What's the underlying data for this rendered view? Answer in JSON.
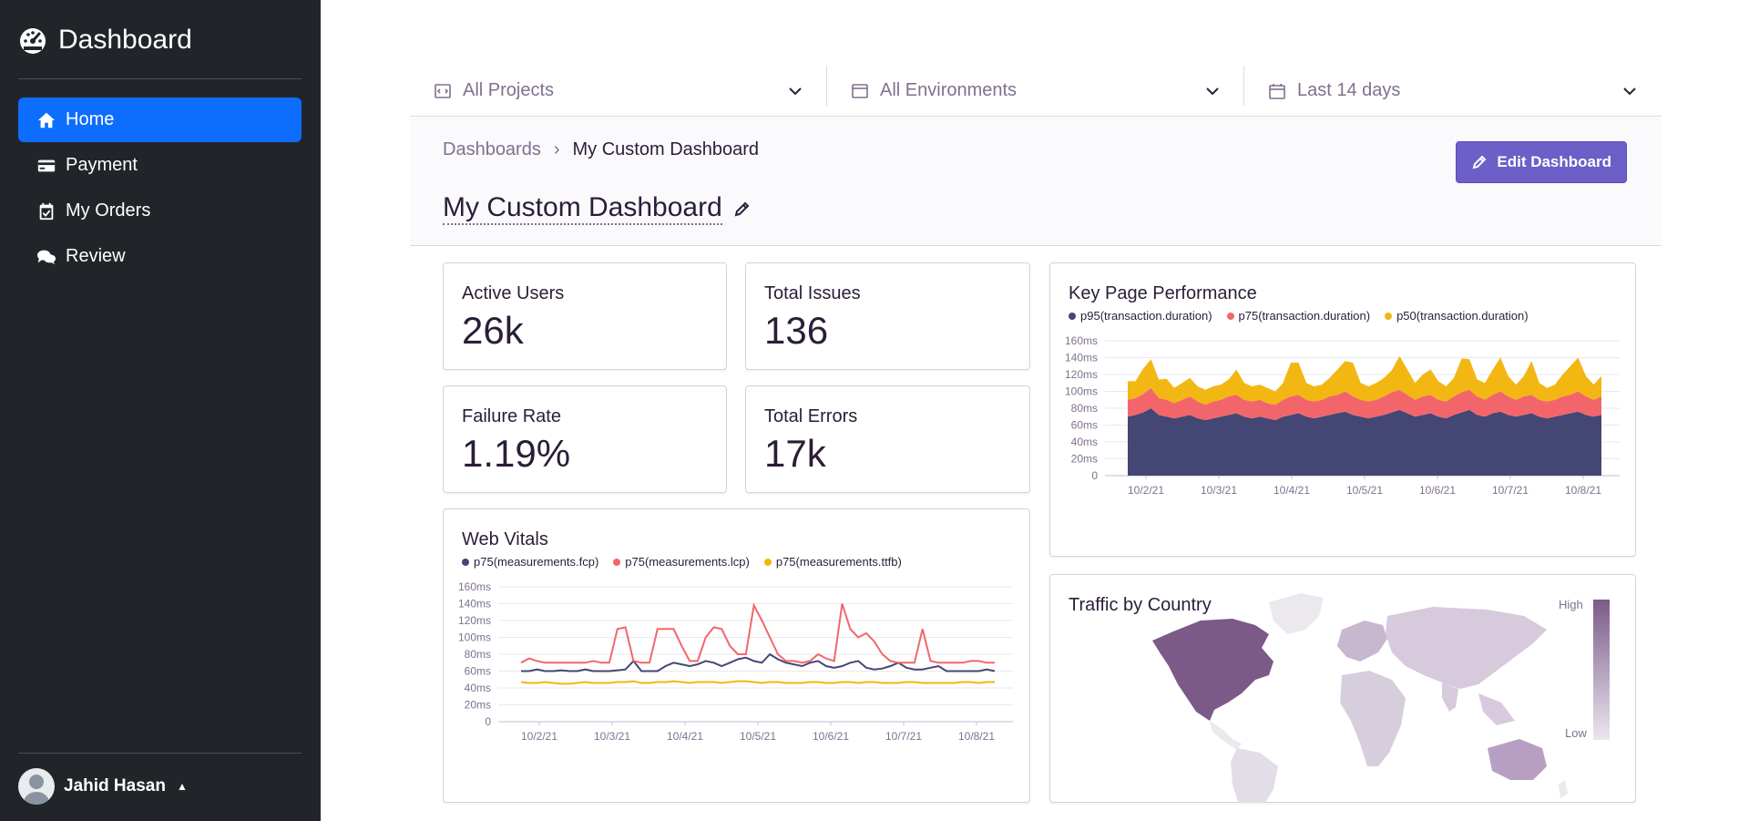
{
  "sidebar": {
    "brand": "Dashboard",
    "items": [
      {
        "label": "Home",
        "icon": "home-icon",
        "active": true
      },
      {
        "label": "Payment",
        "icon": "credit-card-icon"
      },
      {
        "label": "My Orders",
        "icon": "calendar-check-icon"
      },
      {
        "label": "Review",
        "icon": "comments-icon"
      }
    ],
    "user": {
      "name": "Jahid Hasan"
    }
  },
  "filters": {
    "projects": "All Projects",
    "environments": "All Environments",
    "period": "Last 14 days"
  },
  "header": {
    "breadcrumb_root": "Dashboards",
    "breadcrumb_current": "My Custom Dashboard",
    "title": "My Custom Dashboard",
    "edit_button": "Edit Dashboard"
  },
  "stats": [
    {
      "label": "Active Users",
      "value": "26k"
    },
    {
      "label": "Total Issues",
      "value": "136"
    },
    {
      "label": "Failure Rate",
      "value": "1.19%"
    },
    {
      "label": "Total Errors",
      "value": "17k"
    }
  ],
  "colors": {
    "accent": "#6c5fc7",
    "sidebar": "#212529",
    "active_nav": "#0d6efd",
    "series1": "#444674",
    "series2": "#f2666b",
    "series3": "#f2b712"
  },
  "chart_data": [
    {
      "type": "area",
      "title": "Key Page Performance",
      "x_ticks": [
        "10/2/21",
        "10/3/21",
        "10/4/21",
        "10/5/21",
        "10/6/21",
        "10/7/21",
        "10/8/21"
      ],
      "y_ticks": [
        "0",
        "20ms",
        "40ms",
        "60ms",
        "80ms",
        "100ms",
        "120ms",
        "140ms",
        "160ms"
      ],
      "ylim": [
        0,
        160
      ],
      "stacked": true,
      "series": [
        {
          "name": "p95(transaction.duration)",
          "color": "#444674",
          "values": [
            70,
            72,
            75,
            80,
            72,
            70,
            68,
            70,
            72,
            68,
            66,
            68,
            70,
            72,
            74,
            70,
            68,
            70,
            68,
            66,
            70,
            72,
            74,
            70,
            68,
            70,
            72,
            74,
            76,
            72,
            70,
            68,
            70,
            72,
            75,
            78,
            74,
            70,
            72,
            74,
            70,
            68,
            72,
            75,
            78,
            72,
            70,
            74,
            76,
            72,
            70,
            72,
            74,
            70,
            68,
            70,
            72,
            74,
            76,
            72,
            70,
            72
          ]
        },
        {
          "name": "p75(transaction.duration)",
          "color": "#f2666b",
          "values": [
            20,
            20,
            22,
            24,
            20,
            20,
            18,
            20,
            22,
            20,
            18,
            20,
            20,
            22,
            22,
            20,
            20,
            20,
            18,
            18,
            20,
            22,
            22,
            20,
            20,
            20,
            22,
            22,
            24,
            22,
            20,
            20,
            20,
            22,
            24,
            24,
            22,
            20,
            22,
            22,
            20,
            20,
            22,
            24,
            24,
            22,
            20,
            22,
            24,
            22,
            20,
            22,
            22,
            20,
            20,
            20,
            22,
            22,
            24,
            22,
            20,
            22
          ]
        },
        {
          "name": "p50(transaction.duration)",
          "color": "#f2b712",
          "values": [
            22,
            20,
            30,
            34,
            22,
            25,
            18,
            20,
            22,
            18,
            18,
            18,
            18,
            20,
            30,
            20,
            18,
            18,
            18,
            16,
            20,
            40,
            38,
            20,
            18,
            18,
            22,
            30,
            36,
            40,
            20,
            18,
            20,
            22,
            26,
            40,
            30,
            20,
            26,
            30,
            22,
            18,
            22,
            40,
            36,
            20,
            20,
            30,
            40,
            24,
            18,
            24,
            40,
            20,
            16,
            18,
            26,
            34,
            40,
            24,
            18,
            24
          ]
        }
      ]
    },
    {
      "type": "line",
      "title": "Web Vitals",
      "x_ticks": [
        "10/2/21",
        "10/3/21",
        "10/4/21",
        "10/5/21",
        "10/6/21",
        "10/7/21",
        "10/8/21"
      ],
      "y_ticks": [
        "0",
        "20ms",
        "40ms",
        "60ms",
        "80ms",
        "100ms",
        "120ms",
        "140ms",
        "160ms"
      ],
      "ylim": [
        0,
        160
      ],
      "series": [
        {
          "name": "p75(measurements.fcp)",
          "color": "#444674",
          "values": [
            60,
            60,
            62,
            60,
            60,
            61,
            60,
            60,
            62,
            60,
            60,
            60,
            61,
            62,
            72,
            60,
            60,
            60,
            66,
            70,
            68,
            66,
            68,
            72,
            70,
            66,
            70,
            74,
            76,
            72,
            70,
            80,
            74,
            70,
            68,
            66,
            70,
            72,
            66,
            64,
            66,
            70,
            72,
            64,
            62,
            63,
            66,
            70,
            64,
            62,
            62,
            64,
            66,
            60,
            60,
            60,
            60,
            60,
            62,
            60
          ]
        },
        {
          "name": "p75(measurements.lcp)",
          "color": "#f2666b",
          "values": [
            70,
            75,
            72,
            70,
            70,
            70,
            70,
            70,
            70,
            72,
            70,
            70,
            110,
            112,
            72,
            70,
            70,
            110,
            110,
            110,
            90,
            72,
            72,
            100,
            112,
            110,
            90,
            80,
            80,
            138,
            120,
            100,
            80,
            72,
            72,
            70,
            72,
            80,
            75,
            72,
            140,
            110,
            100,
            105,
            95,
            80,
            72,
            70,
            70,
            70,
            110,
            72,
            70,
            70,
            70,
            70,
            72,
            72,
            70,
            70
          ]
        },
        {
          "name": "p75(measurements.ttfb)",
          "color": "#f2b712",
          "values": [
            47,
            46,
            46,
            47,
            46,
            45,
            45,
            46,
            47,
            46,
            46,
            46,
            47,
            47,
            48,
            46,
            46,
            47,
            47,
            48,
            47,
            46,
            47,
            47,
            47,
            46,
            47,
            48,
            48,
            47,
            46,
            47,
            47,
            46,
            46,
            46,
            47,
            47,
            46,
            46,
            47,
            47,
            46,
            47,
            47,
            46,
            46,
            46,
            47,
            47,
            46,
            46,
            46,
            46,
            46,
            47,
            47,
            46,
            47,
            47
          ]
        }
      ]
    }
  ],
  "map": {
    "title": "Traffic by Country",
    "legend_high": "High",
    "legend_low": "Low"
  }
}
